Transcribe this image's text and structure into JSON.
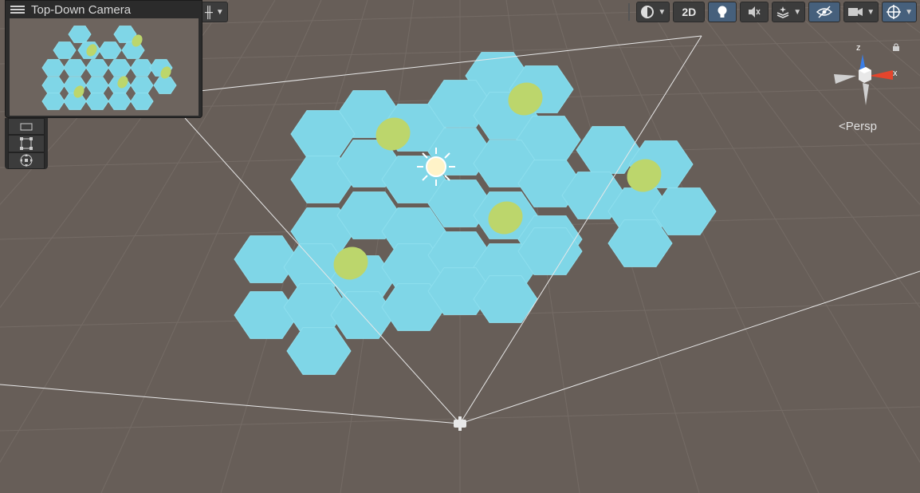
{
  "overlay": {
    "title": "Top-Down Camera"
  },
  "toolbar": {
    "mode_2d_label": "2D"
  },
  "gizmo": {
    "axis_z": "z",
    "axis_x": "x",
    "projection_label": "Persp"
  },
  "colors": {
    "ground": "#675e58",
    "tile": "#7fd6e7",
    "tile_edge": "#8edfee",
    "island": "#bcd66c",
    "panel": "#2b2b2b",
    "button": "#3c3c3c",
    "button_active": "#46607c",
    "axis_x": "#e4452c",
    "axis_z": "#3a7ee8"
  }
}
